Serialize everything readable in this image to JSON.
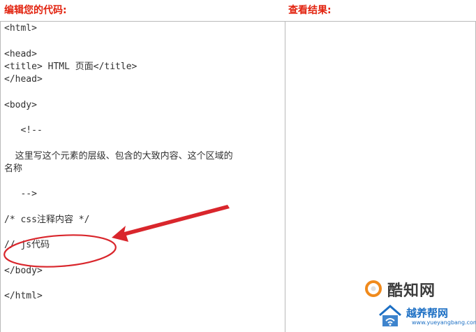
{
  "headings": {
    "editor": "编辑您的代码:",
    "result": "查看结果:",
    "color": "#e2230f"
  },
  "editor": {
    "lines": [
      "<html>",
      "",
      "<head>",
      "<title> HTML 页面</title>",
      "</head>",
      "",
      "<body>",
      "",
      "   <!--",
      "",
      "  这里写这个元素的层级、包含的大致内容、这个区域的",
      "名称",
      "",
      "   -->",
      "",
      "/* css注释内容 */",
      "",
      "// js代码",
      "",
      "</body>",
      "",
      "</html>"
    ]
  },
  "annotation": {
    "color": "#d9262c"
  },
  "watermarks": {
    "site1": {
      "text": "酷知网",
      "icon": "kuzhi-logo-icon",
      "color": "#f08a1c"
    },
    "site2": {
      "text": "越养帮网",
      "url": "www.yueyangbang.com",
      "icon": "wifi-house-logo-icon",
      "color": "#1c6fc4"
    }
  }
}
